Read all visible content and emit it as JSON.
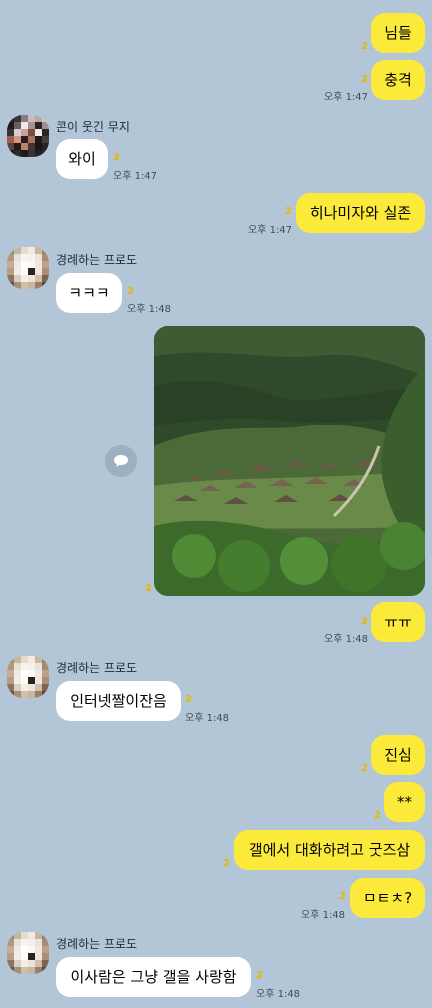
{
  "messages": [
    {
      "id": "m1",
      "text": "님들",
      "unread": "2",
      "time": ""
    },
    {
      "id": "m2",
      "text": "충격",
      "unread": "2",
      "time": "오후 1:47"
    },
    {
      "id": "m3",
      "sender": "콘이 웃긴 무지",
      "text": "와이",
      "unread": "2",
      "time": "오후 1:47"
    },
    {
      "id": "m4",
      "text": "히나미자와 실존",
      "unread": "2",
      "time": "오후 1:47"
    },
    {
      "id": "m5",
      "sender": "경례하는 프로도",
      "text": "ㅋㅋㅋ",
      "unread": "2",
      "time": "오후 1:48"
    },
    {
      "id": "m6",
      "image": "mountain village photo",
      "unread": "2",
      "time": ""
    },
    {
      "id": "m7",
      "text": "ㅠㅠ",
      "unread": "2",
      "time": "오후 1:48"
    },
    {
      "id": "m8",
      "sender": "경례하는 프로도",
      "text": "인터넷짤이잔음",
      "unread": "2",
      "time": "오후 1:48"
    },
    {
      "id": "m9",
      "text": "진심",
      "unread": "2",
      "time": ""
    },
    {
      "id": "m10",
      "text": "**",
      "unread": "2",
      "time": ""
    },
    {
      "id": "m11",
      "text": "갤에서 대화하려고 굿즈삼",
      "unread": "2",
      "time": ""
    },
    {
      "id": "m12",
      "text": "ㅁㅌㅊ?",
      "unread": "2",
      "time": "오후 1:48"
    },
    {
      "id": "m13",
      "sender": "경례하는 프로도",
      "text": "이사람은 그냥 갤을 사랑함",
      "unread": "2",
      "time": "오후 1:48"
    }
  ],
  "icons": {
    "share": "share-icon"
  },
  "colors": {
    "background": "#b3c6d8",
    "mine": "#fcea3b",
    "theirs": "#ffffff",
    "unread": "#e6b800"
  }
}
